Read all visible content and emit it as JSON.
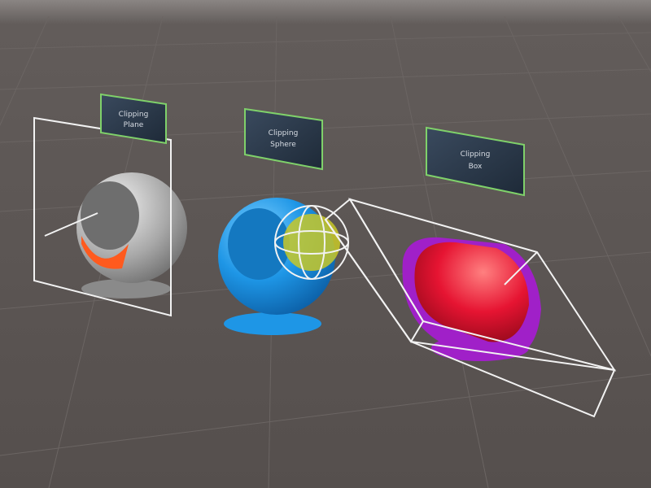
{
  "scene": {
    "background_color": "#5a5452",
    "panels": [
      {
        "line1": "Clipping",
        "line2": "Plane",
        "border_color": "#7fd16a"
      },
      {
        "line1": "Clipping",
        "line2": "Sphere",
        "border_color": "#7fd16a"
      },
      {
        "line1": "Clipping",
        "line2": "Box",
        "border_color": "#7fd16a"
      }
    ],
    "objects": [
      {
        "name": "gray-sphere",
        "color": "#c8c8c8",
        "clip_color": "#ff5a1e"
      },
      {
        "name": "blue-sphere",
        "color": "#1e96e6",
        "clip_color": "#c8c828"
      },
      {
        "name": "red-sphere",
        "color": "#e61432",
        "clip_color": "#a020c8"
      }
    ]
  }
}
